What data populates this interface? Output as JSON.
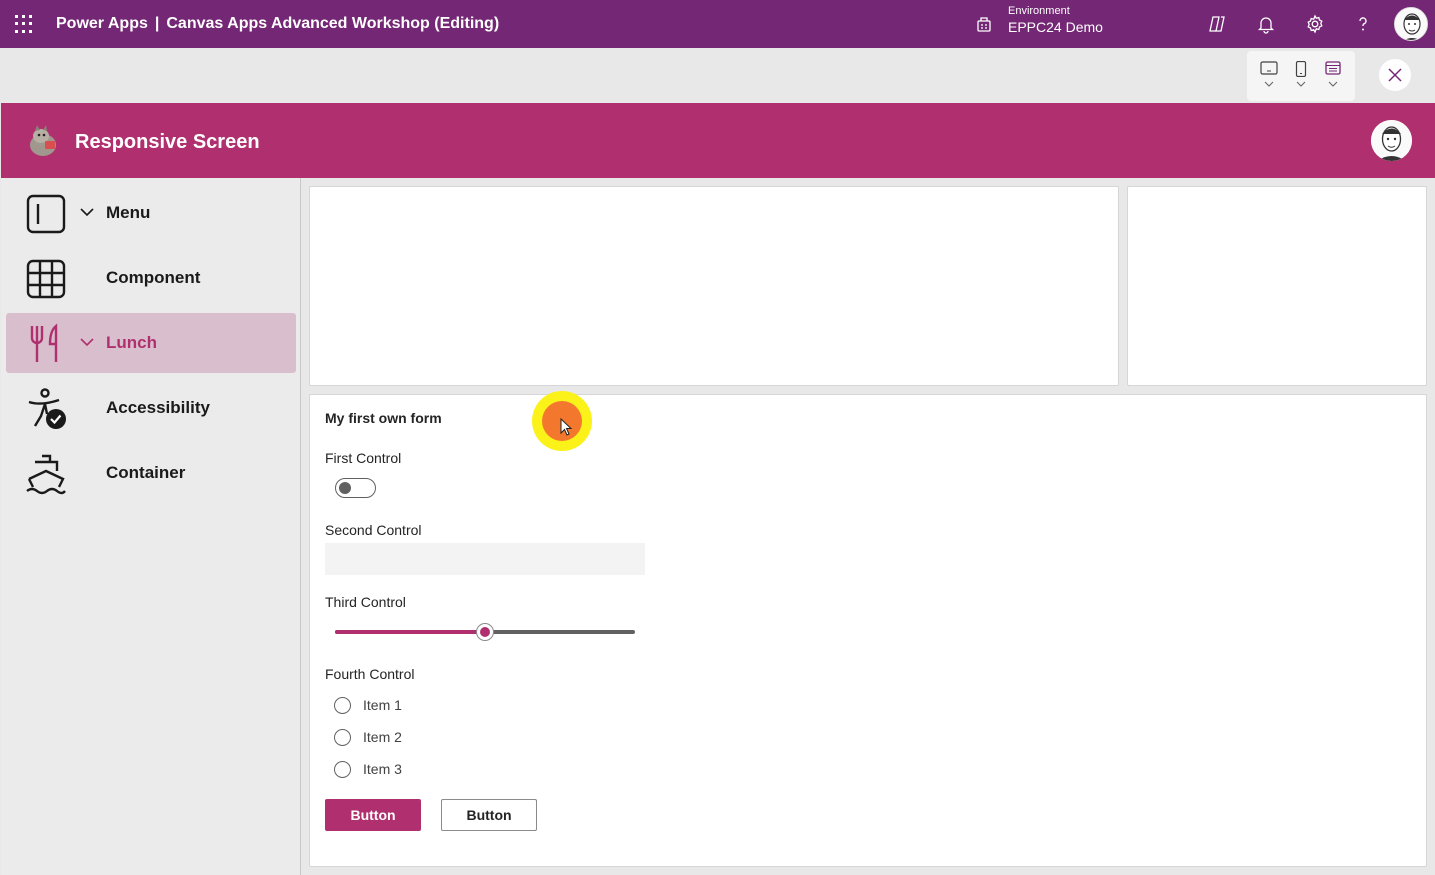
{
  "topbar": {
    "product": "Power Apps",
    "separator": "|",
    "app_name": "Canvas Apps Advanced Workshop (Editing)",
    "environment_label": "Environment",
    "environment_name": "EPPC24 Demo",
    "icons": [
      "waffle-icon",
      "environment-icon",
      "copilot-icon",
      "bell-icon",
      "gear-icon",
      "help-icon",
      "user-avatar"
    ]
  },
  "preview_toolbar": {
    "device_buttons": [
      "tablet-icon",
      "phone-icon",
      "web-icon"
    ],
    "close_icon": "close-icon"
  },
  "app_header": {
    "title": "Responsive Screen"
  },
  "sidebar": {
    "items": [
      {
        "label": "Menu",
        "icon": "sidebar-icon",
        "has_chevron": true,
        "selected": false
      },
      {
        "label": "Component",
        "icon": "grid-icon",
        "has_chevron": false,
        "selected": false
      },
      {
        "label": "Lunch",
        "icon": "cutlery-icon",
        "has_chevron": true,
        "selected": true
      },
      {
        "label": "Accessibility",
        "icon": "accessibility-icon",
        "has_chevron": false,
        "selected": false
      },
      {
        "label": "Container",
        "icon": "ship-icon",
        "has_chevron": false,
        "selected": false
      }
    ]
  },
  "form": {
    "title": "My first own form",
    "first_control": {
      "label": "First Control",
      "value": false
    },
    "second_control": {
      "label": "Second Control",
      "value": ""
    },
    "third_control": {
      "label": "Third Control",
      "value_fraction": 0.5
    },
    "fourth_control": {
      "label": "Fourth Control",
      "options": [
        "Item 1",
        "Item 2",
        "Item 3"
      ]
    },
    "primary_button": "Button",
    "secondary_button": "Button"
  },
  "colors": {
    "topbar": "#742774",
    "accent": "#b0306f",
    "selected_nav": "#d9bfcd",
    "background": "#e8e8e8"
  }
}
